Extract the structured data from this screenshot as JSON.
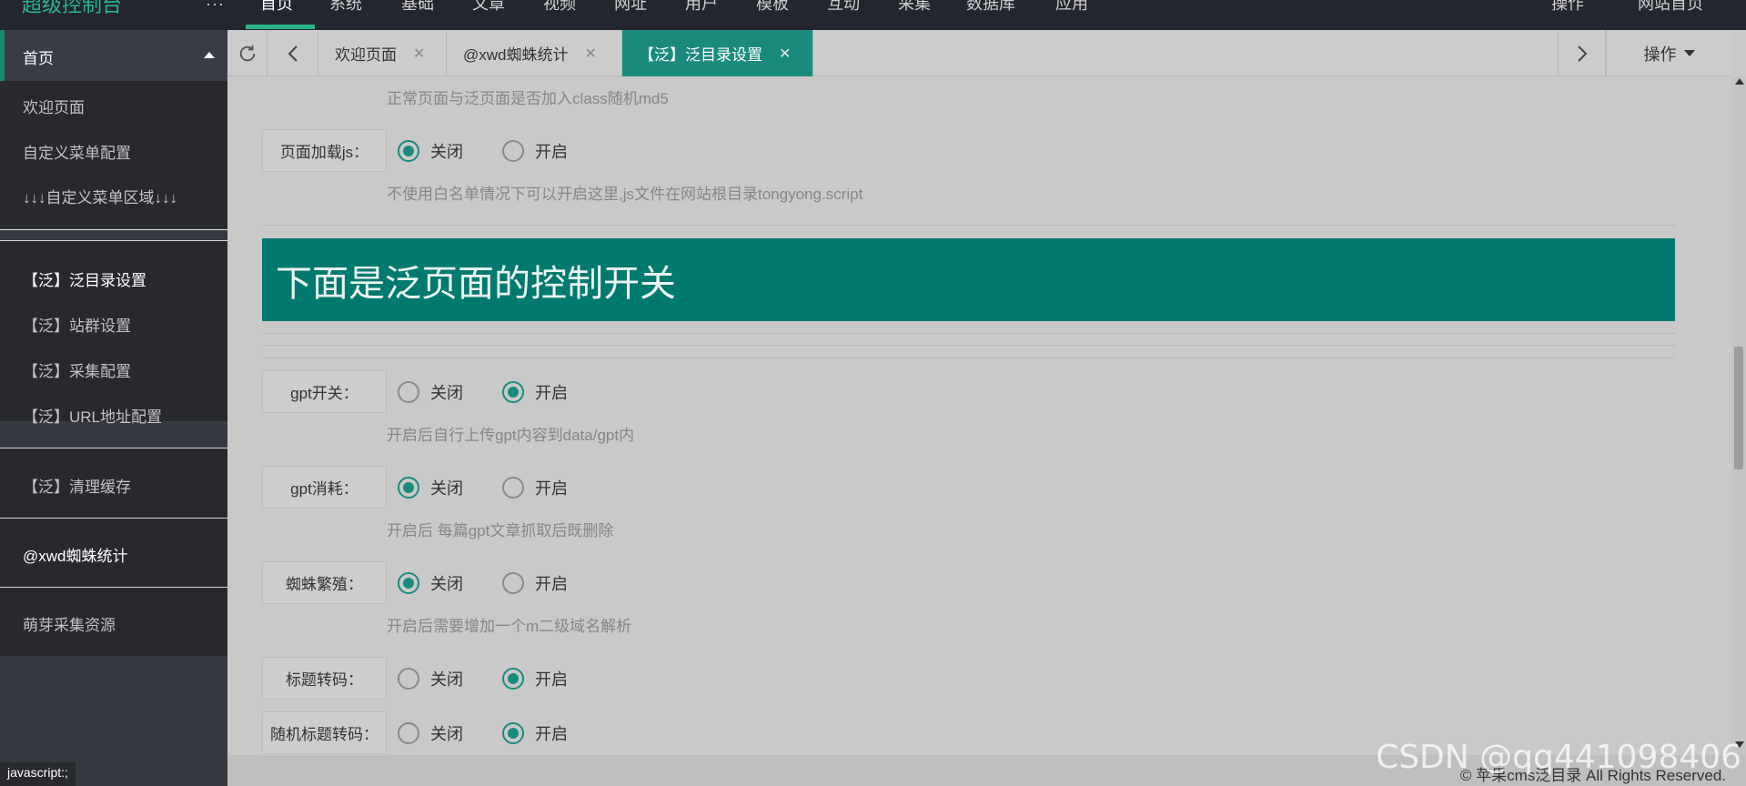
{
  "topnav": {
    "logo": "超级控制台",
    "more": "···",
    "items": [
      "首页",
      "系统",
      "基础",
      "文章",
      "视频",
      "网址",
      "用户",
      "模板",
      "互动",
      "采集",
      "数据库",
      "应用"
    ],
    "right_items": [
      "操作",
      "网站首页"
    ]
  },
  "sidebar": {
    "head": "首页",
    "group1": [
      "欢迎页面",
      "自定义菜单配置",
      "↓↓↓自定义菜单区域↓↓↓"
    ],
    "group2": [
      "【泛】泛目录设置",
      "【泛】站群设置",
      "【泛】采集配置",
      "【泛】URL地址配置"
    ],
    "group3": [
      "【泛】清理缓存"
    ],
    "group4": [
      "@xwd蜘蛛统计"
    ],
    "group5": [
      "萌芽采集资源"
    ]
  },
  "status_bar_text": "javascript:;",
  "tabs": [
    {
      "label": "欢迎页面"
    },
    {
      "label": "@xwd蜘蛛统计"
    },
    {
      "label": "【泛】泛目录设置"
    }
  ],
  "ops_label": "操作",
  "form": {
    "top_hint": "正常页面与泛页面是否加入class随机md5",
    "page_js": {
      "label": "页面加载js：",
      "off": "关闭",
      "on": "开启",
      "hint": "不使用白名单情况下可以开启这里,js文件在网站根目录tongyong.script"
    },
    "banner": "下面是泛页面的控制开关",
    "gpt_switch": {
      "label": "gpt开关：",
      "off": "关闭",
      "on": "开启",
      "hint": "开启后自行上传gpt内容到data/gpt内"
    },
    "gpt_consume": {
      "label": "gpt消耗：",
      "off": "关闭",
      "on": "开启",
      "hint": "开启后 每篇gpt文章抓取后既删除"
    },
    "spider_breed": {
      "label": "蜘蛛繁殖：",
      "off": "关闭",
      "on": "开启",
      "hint": "开启后需要增加一个m二级域名解析"
    },
    "title_transcode": {
      "label": "标题转码：",
      "off": "关闭",
      "on": "开启"
    },
    "random_title_transcode": {
      "label": "随机标题转码：",
      "off": "关闭",
      "on": "开启"
    }
  },
  "footer": {
    "copyright": "© 苹果cms泛目录 All Rights Reserved."
  },
  "watermark": "CSDN @qq441098406",
  "colors": {
    "accent": "#1a8a7e",
    "banner": "#007a6e",
    "nav_bg": "#23262e",
    "sidebar_bg": "#28292f"
  }
}
